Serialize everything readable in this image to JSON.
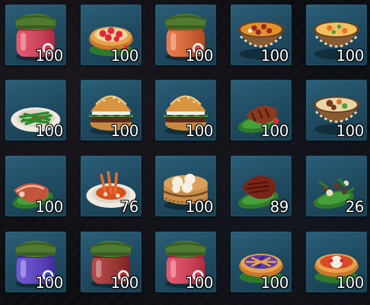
{
  "inventory": {
    "slots": [
      {
        "item": "strawberry-jam-jar-icon",
        "quantity": "100"
      },
      {
        "item": "strawberry-tart-icon",
        "quantity": "100"
      },
      {
        "item": "orange-jam-jar-icon",
        "quantity": "100"
      },
      {
        "item": "sausage-stew-bowl-icon",
        "quantity": "100"
      },
      {
        "item": "vegetable-soup-bowl-icon",
        "quantity": "100"
      },
      {
        "item": "green-bean-salad-icon",
        "quantity": "100"
      },
      {
        "item": "hamburger-icon",
        "quantity": "100"
      },
      {
        "item": "hamburger-icon",
        "quantity": "100"
      },
      {
        "item": "roast-ribs-icon",
        "quantity": "100"
      },
      {
        "item": "meat-stew-bowl-icon",
        "quantity": "100"
      },
      {
        "item": "roast-ham-icon",
        "quantity": "100"
      },
      {
        "item": "seafood-platter-icon",
        "quantity": "76"
      },
      {
        "item": "dumpling-steamer-icon",
        "quantity": "100"
      },
      {
        "item": "steak-icon",
        "quantity": "89"
      },
      {
        "item": "herb-meat-stir-fry-icon",
        "quantity": "26"
      },
      {
        "item": "blueberry-jam-jar-icon",
        "quantity": "100"
      },
      {
        "item": "red-jam-jar-icon",
        "quantity": "100"
      },
      {
        "item": "strawberry-jam-jar-icon",
        "quantity": "100"
      },
      {
        "item": "blueberry-pie-icon",
        "quantity": "100"
      },
      {
        "item": "apple-tart-icon",
        "quantity": "100"
      }
    ]
  },
  "colors": {
    "slot_background": "#245368",
    "quantity_text": "#ffffff",
    "page_background": "#0c0d11"
  }
}
